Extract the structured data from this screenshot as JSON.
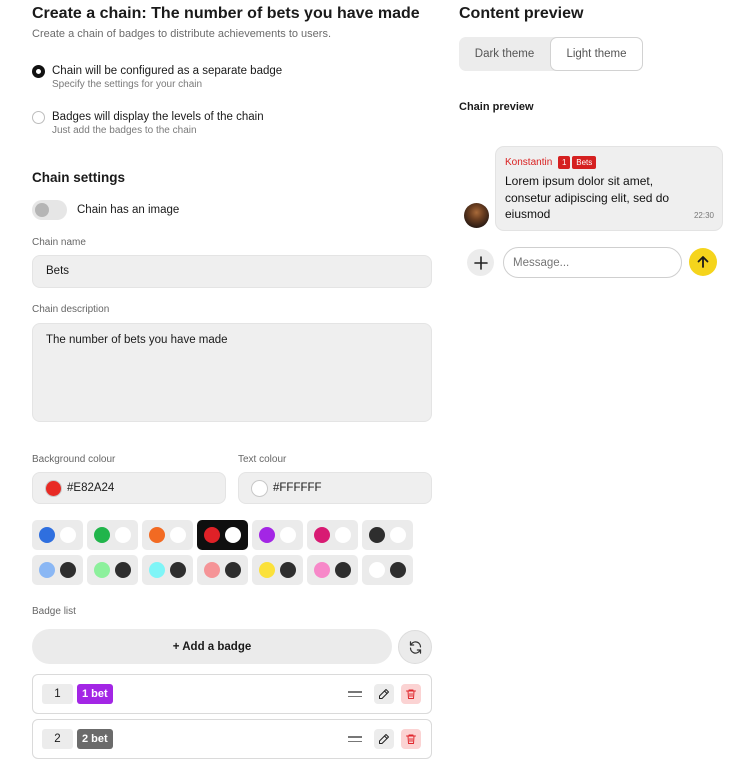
{
  "header": {
    "title": "Create a chain: The number of bets you have made",
    "subtitle": "Create a chain of badges to distribute achievements to users."
  },
  "mode_options": [
    {
      "title": "Chain will be configured as a separate badge",
      "desc": "Specify the settings for your chain",
      "selected": true
    },
    {
      "title": "Badges will display the levels of the chain",
      "desc": "Just add the badges to the chain",
      "selected": false
    }
  ],
  "settings": {
    "title": "Chain settings",
    "has_image_label": "Chain has an image",
    "has_image": false,
    "name_label": "Chain name",
    "name_value": "Bets",
    "description_label": "Chain description",
    "description_value": "The number of bets you have made",
    "bg_label": "Background colour",
    "bg_value": "#E82A24",
    "text_label": "Text colour",
    "text_value": "#FFFFFF"
  },
  "palette": [
    {
      "bg": "#2f6fdf",
      "fg": "#ffffff",
      "selected": false
    },
    {
      "bg": "#21b54b",
      "fg": "#ffffff",
      "selected": false
    },
    {
      "bg": "#f26a22",
      "fg": "#ffffff",
      "selected": false
    },
    {
      "bg": "#e02127",
      "fg": "#ffffff",
      "selected": true
    },
    {
      "bg": "#a326e5",
      "fg": "#ffffff",
      "selected": false
    },
    {
      "bg": "#d81b73",
      "fg": "#ffffff",
      "selected": false
    },
    {
      "bg": "#2e2e2e",
      "fg": "#ffffff",
      "selected": false
    },
    {
      "bg": "#8ab7f4",
      "fg": "#2e2e2e",
      "selected": false
    },
    {
      "bg": "#8cf09c",
      "fg": "#2e2e2e",
      "selected": false
    },
    {
      "bg": "#7ff5f7",
      "fg": "#2e2e2e",
      "selected": false
    },
    {
      "bg": "#f59497",
      "fg": "#2e2e2e",
      "selected": false
    },
    {
      "bg": "#fbe13a",
      "fg": "#2e2e2e",
      "selected": false
    },
    {
      "bg": "#f788c9",
      "fg": "#2e2e2e",
      "selected": false
    },
    {
      "bg": "#ffffff",
      "fg": "#2e2e2e",
      "selected": false
    }
  ],
  "badges": {
    "label": "Badge list",
    "add_label": "+ Add a badge",
    "items": [
      {
        "num": "1",
        "name": "1 bet",
        "color": "#a326e5"
      },
      {
        "num": "2",
        "name": "2 bet",
        "color": "#6b6b6b"
      }
    ]
  },
  "preview": {
    "title": "Content preview",
    "themes": [
      "Dark theme",
      "Light theme"
    ],
    "active_theme": "Light theme",
    "chain_label": "Chain preview",
    "message": {
      "author": "Konstantin",
      "level": "1",
      "badge": "Bets",
      "text": "Lorem ipsum dolor sit amet, consetur adipiscing elit, sed do eiusmod",
      "time": "22:30"
    },
    "input_placeholder": "Message..."
  },
  "colors": {
    "accent_red": "#d52020",
    "send_yellow": "#f5d41c",
    "delete_bg": "#fbd3d3"
  }
}
